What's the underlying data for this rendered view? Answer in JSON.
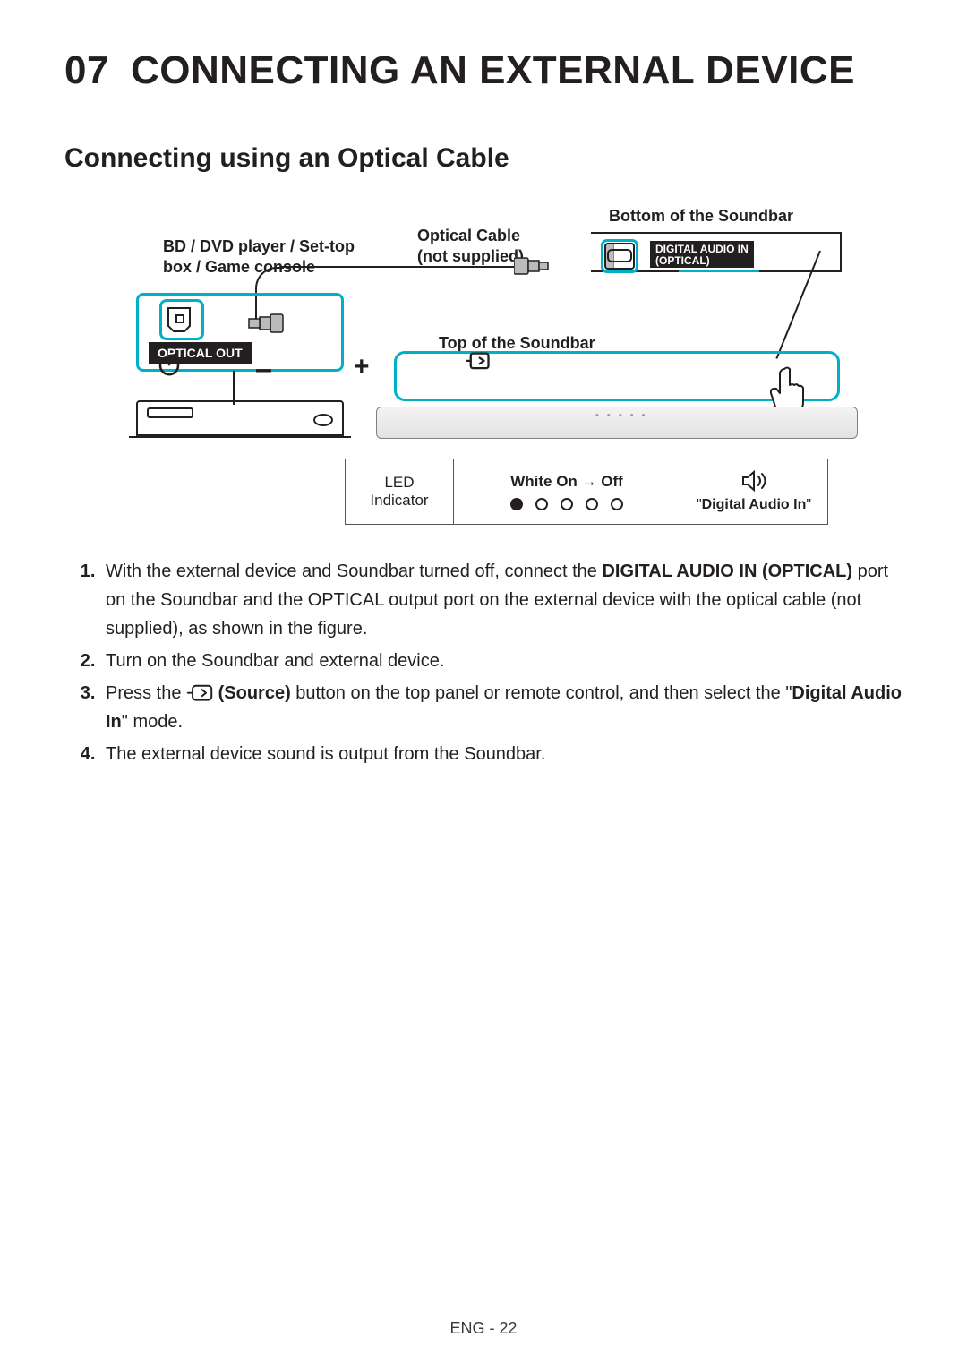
{
  "section_number": "07",
  "section_title": "CONNECTING AN EXTERNAL DEVICE",
  "subsection_title": "Connecting using an Optical Cable",
  "figure": {
    "external_device_label": "BD / DVD player / Set-top box / Game console",
    "cable_label_l1": "Optical Cable",
    "cable_label_l2": "(not supplied)",
    "bottom_label": "Bottom of the Soundbar",
    "top_label": "Top of the Soundbar",
    "optical_out": "OPTICAL OUT",
    "port_label_l1": "DIGITAL AUDIO IN",
    "port_label_l2": "(OPTICAL)",
    "legend": {
      "indicator_l1": "LED",
      "indicator_l2": "Indicator",
      "led_state": "White On → Off",
      "mode_txt": "\"Digital Audio In\""
    }
  },
  "steps": {
    "s1a": "With the external device and Soundbar turned off, connect the ",
    "s1b": "DIGITAL AUDIO IN (OPTICAL)",
    "s1c": " port on the Soundbar and the OPTICAL output port on the external device with the optical cable (not supplied), as shown in the figure.",
    "s2": "Turn on the Soundbar and external device.",
    "s3a": "Press the ",
    "s3b": " (Source)",
    "s3c": " button on the top panel or remote control, and then select the \"",
    "s3d": "Digital Audio In",
    "s3e": "\" mode.",
    "s4": "The external device sound is output from the Soundbar."
  },
  "footer": "ENG - 22"
}
